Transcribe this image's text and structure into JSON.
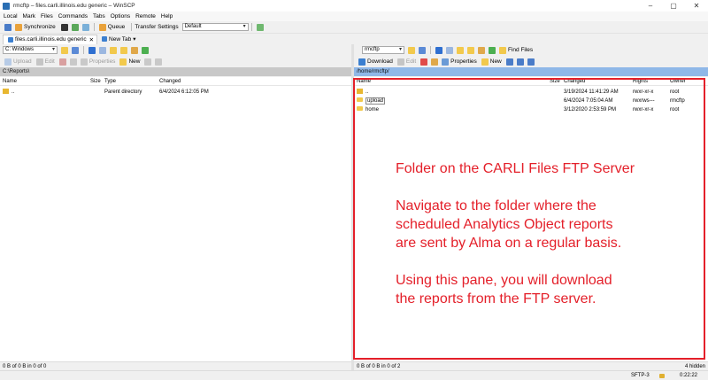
{
  "window": {
    "title": "rmcftp – files.carli.illinois.edu generic – WinSCP"
  },
  "menu": [
    "Local",
    "Mark",
    "Files",
    "Commands",
    "Tabs",
    "Options",
    "Remote",
    "Help"
  ],
  "toolbar": {
    "synchronize": "Synchronize",
    "queue": "Queue",
    "transfer_settings": "Transfer Settings",
    "transfer_value": "Default"
  },
  "tabs": {
    "session": "files.carli.illinois.edu generic",
    "new_tab": "New Tab"
  },
  "left": {
    "drive": "C: Windows",
    "upload": "Upload",
    "edit": "Edit",
    "properties": "Properties",
    "new": "New",
    "path": "C:\\Reports\\",
    "columns": [
      "Name",
      "Size",
      "Type",
      "Changed"
    ],
    "rows": [
      {
        "name": "..",
        "size": "",
        "type": "Parent directory",
        "changed": "6/4/2024 6:12:05 PM"
      }
    ],
    "status": "0 B of 0 B in 0 of 0"
  },
  "right": {
    "drive": "rmcftp",
    "find_files": "Find Files",
    "download": "Download",
    "edit": "Edit",
    "properties": "Properties",
    "new": "New",
    "path": "/home/rmcftp/",
    "columns": [
      "Name",
      "Size",
      "Changed",
      "Rights",
      "Owner"
    ],
    "rows": [
      {
        "name": "..",
        "changed": "3/19/2024 11:41:29 AM",
        "rights": "rwxr-xr-x",
        "owner": "root"
      },
      {
        "name": "upload",
        "changed": "6/4/2024 7:05:04 AM",
        "rights": "rwxrws---",
        "owner": "rmcftp"
      },
      {
        "name": "home",
        "changed": "3/12/2020 2:53:59 PM",
        "rights": "rwxr-xr-x",
        "owner": "root"
      }
    ],
    "status": "0 B of 0 B in 0 of 2",
    "hidden": "4 hidden"
  },
  "bottom": {
    "protocol": "SFTP-3",
    "time": "0:22:22"
  },
  "annotation": {
    "line1": "Folder on the CARLI Files FTP Server",
    "line2": "Navigate to the folder where the",
    "line3": "scheduled Analytics Object reports",
    "line4": "are sent by Alma on a regular basis.",
    "line5": "Using this pane, you will download",
    "line6": "the reports from the FTP server."
  },
  "colors": {
    "annotation_red": "#e4202a",
    "remote_path_bar": "#8fb8e8"
  }
}
